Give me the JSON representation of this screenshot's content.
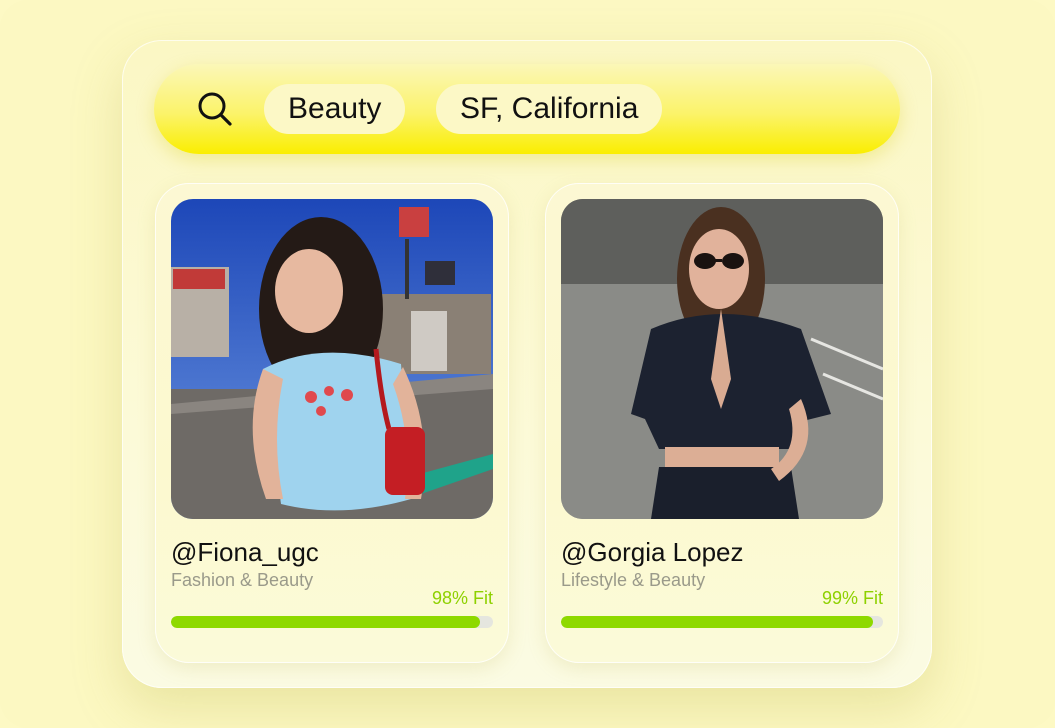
{
  "search": {
    "icon": "search-icon",
    "filters": [
      "Beauty",
      "SF, California"
    ]
  },
  "creators": [
    {
      "handle": "@Fiona_ugc",
      "category": "Fashion & Beauty",
      "fit_label": "98% Fit",
      "fit": 0.98,
      "photo": "street-portrait-photo"
    },
    {
      "handle": "@Gorgia Lopez",
      "category": "Lifestyle & Beauty",
      "fit_label": "99% Fit",
      "fit": 0.99,
      "photo": "denim-sunglasses-portrait-photo"
    }
  ],
  "colors": {
    "accent_yellow": "#faee00",
    "fit_green": "#8ed900",
    "background": "#fcf8c2"
  }
}
